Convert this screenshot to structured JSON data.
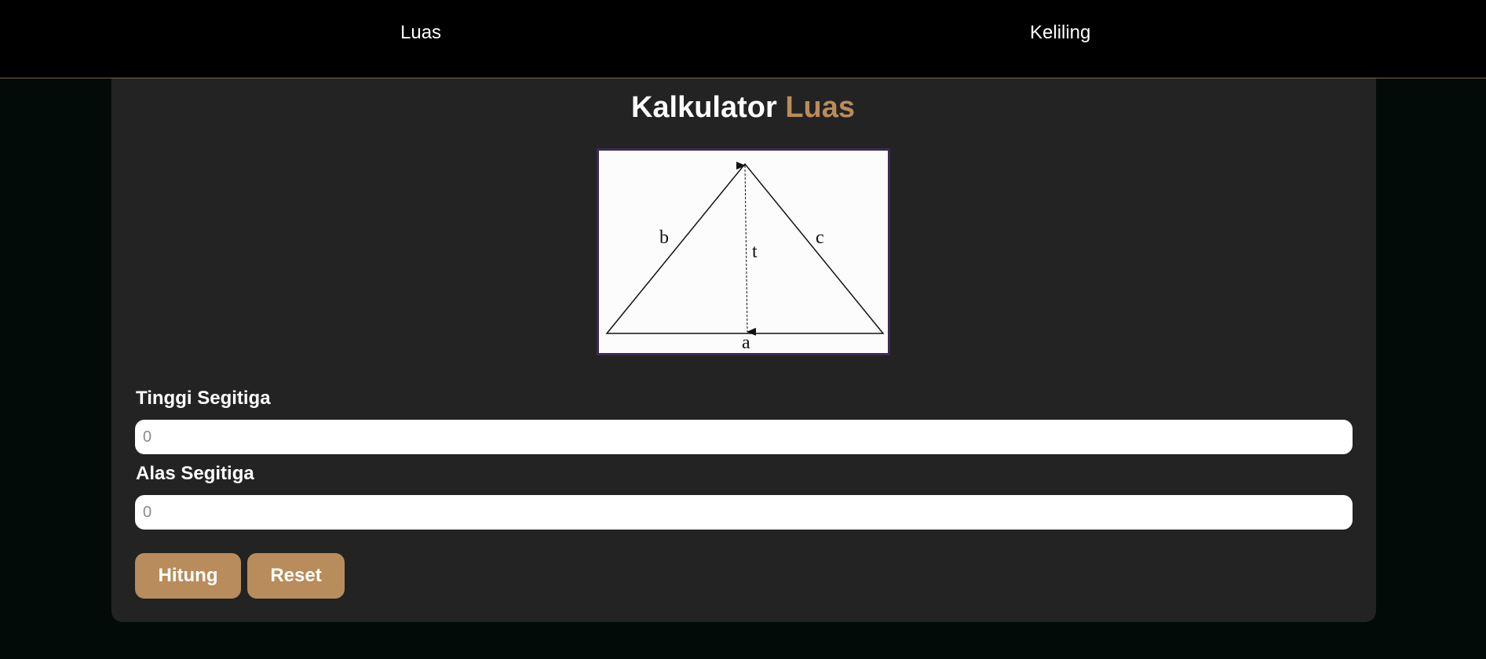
{
  "nav": {
    "luas_label": "Luas",
    "keliling_label": "Keliling"
  },
  "header": {
    "title_prefix": "Kalkulator",
    "title_accent": "Luas"
  },
  "figure": {
    "label_b": "b",
    "label_c": "c",
    "label_t": "t",
    "label_a": "a"
  },
  "form": {
    "tinggi_label": "Tinggi Segitiga",
    "tinggi_placeholder": "0",
    "alas_label": "Alas Segitiga",
    "alas_placeholder": "0"
  },
  "buttons": {
    "hitung_label": "Hitung",
    "reset_label": "Reset"
  },
  "colors": {
    "accent": "#b98c5c",
    "background": "#020b08",
    "card": "#232323",
    "navbar": "#000000"
  }
}
